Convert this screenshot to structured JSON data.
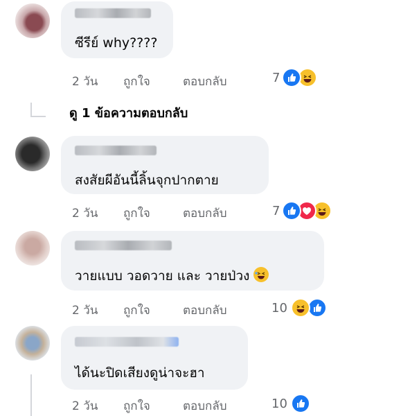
{
  "comments": [
    {
      "text": "ซีรีย์ why????",
      "time": "2 วัน",
      "like_label": "ถูกใจ",
      "reply_label": "ตอบกลับ",
      "reaction_count": "7",
      "reactions": [
        "like-icon",
        "haha-icon"
      ]
    },
    {
      "text": "สงสัยผีอันนี้ลิ้นจุกปากตาย",
      "time": "2 วัน",
      "like_label": "ถูกใจ",
      "reply_label": "ตอบกลับ",
      "reaction_count": "7",
      "reactions": [
        "like-icon",
        "love-icon",
        "haha-icon"
      ]
    },
    {
      "text": "วายแบบ วอดวาย และ วายป่วง",
      "time": "2 วัน",
      "like_label": "ถูกใจ",
      "reply_label": "ตอบกลับ",
      "reaction_count": "10",
      "reactions": [
        "haha-icon",
        "like-icon"
      ]
    },
    {
      "text": "ได้นะปิดเสียงดูน่าจะฮา",
      "time": "2 วัน",
      "like_label": "ถูกใจ",
      "reply_label": "ตอบกลับ",
      "reaction_count": "10",
      "reactions": [
        "like-icon"
      ]
    }
  ],
  "view_replies": "ดู 1 ข้อความตอบกลับ",
  "colors": {
    "bubble": "#f0f2f5",
    "like": "#1877f2",
    "haha": "#f7c02b",
    "love": "#f0284a",
    "meta_text": "#65676b"
  }
}
